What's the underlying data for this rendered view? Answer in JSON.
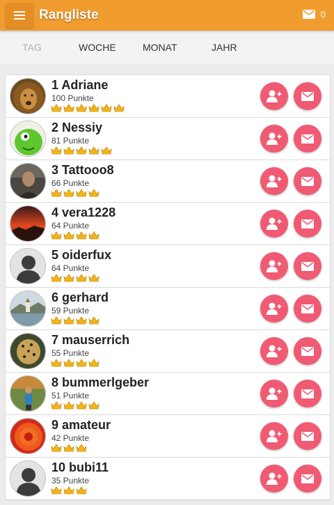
{
  "header": {
    "title": "Rangliste",
    "message_count": "0"
  },
  "tabs": [
    {
      "label": "TAG",
      "active": false
    },
    {
      "label": "WOCHE",
      "active": true
    },
    {
      "label": "MONAT",
      "active": true
    },
    {
      "label": "JAHR",
      "active": true
    }
  ],
  "ranking": [
    {
      "rank_name": "1 Adriane",
      "points": "100 Punkte",
      "crowns": 6,
      "avatar": "lion"
    },
    {
      "rank_name": "2 Nessiy",
      "points": "81 Punkte",
      "crowns": 5,
      "avatar": "green-creature"
    },
    {
      "rank_name": "3 Tattooo8",
      "points": "66 Punkte",
      "crowns": 4,
      "avatar": "man-photo"
    },
    {
      "rank_name": "4 vera1228",
      "points": "64 Punkte",
      "crowns": 4,
      "avatar": "sunset"
    },
    {
      "rank_name": "5 oiderfux",
      "points": "64 Punkte",
      "crowns": 4,
      "avatar": "default-silhouette"
    },
    {
      "rank_name": "6 gerhard",
      "points": "59 Punkte",
      "crowns": 4,
      "avatar": "lake-church"
    },
    {
      "rank_name": "7 mauserrich",
      "points": "55 Punkte",
      "crowns": 4,
      "avatar": "leopard"
    },
    {
      "rank_name": "8 bummerlgeber",
      "points": "51 Punkte",
      "crowns": 4,
      "avatar": "person-outdoors"
    },
    {
      "rank_name": "9 amateur",
      "points": "42 Punkte",
      "crowns": 3,
      "avatar": "red-flower"
    },
    {
      "rank_name": "10 bubi11",
      "points": "35 Punkte",
      "crowns": 3,
      "avatar": "default-silhouette"
    }
  ],
  "colors": {
    "accent": "#f19c2f",
    "action": "#f05a73",
    "crown": "#f3b51b"
  },
  "icons": {
    "menu": "hamburger-icon",
    "mail": "mail-icon",
    "add_friend": "add-person-icon",
    "message": "envelope-icon",
    "crown": "crown-icon"
  }
}
